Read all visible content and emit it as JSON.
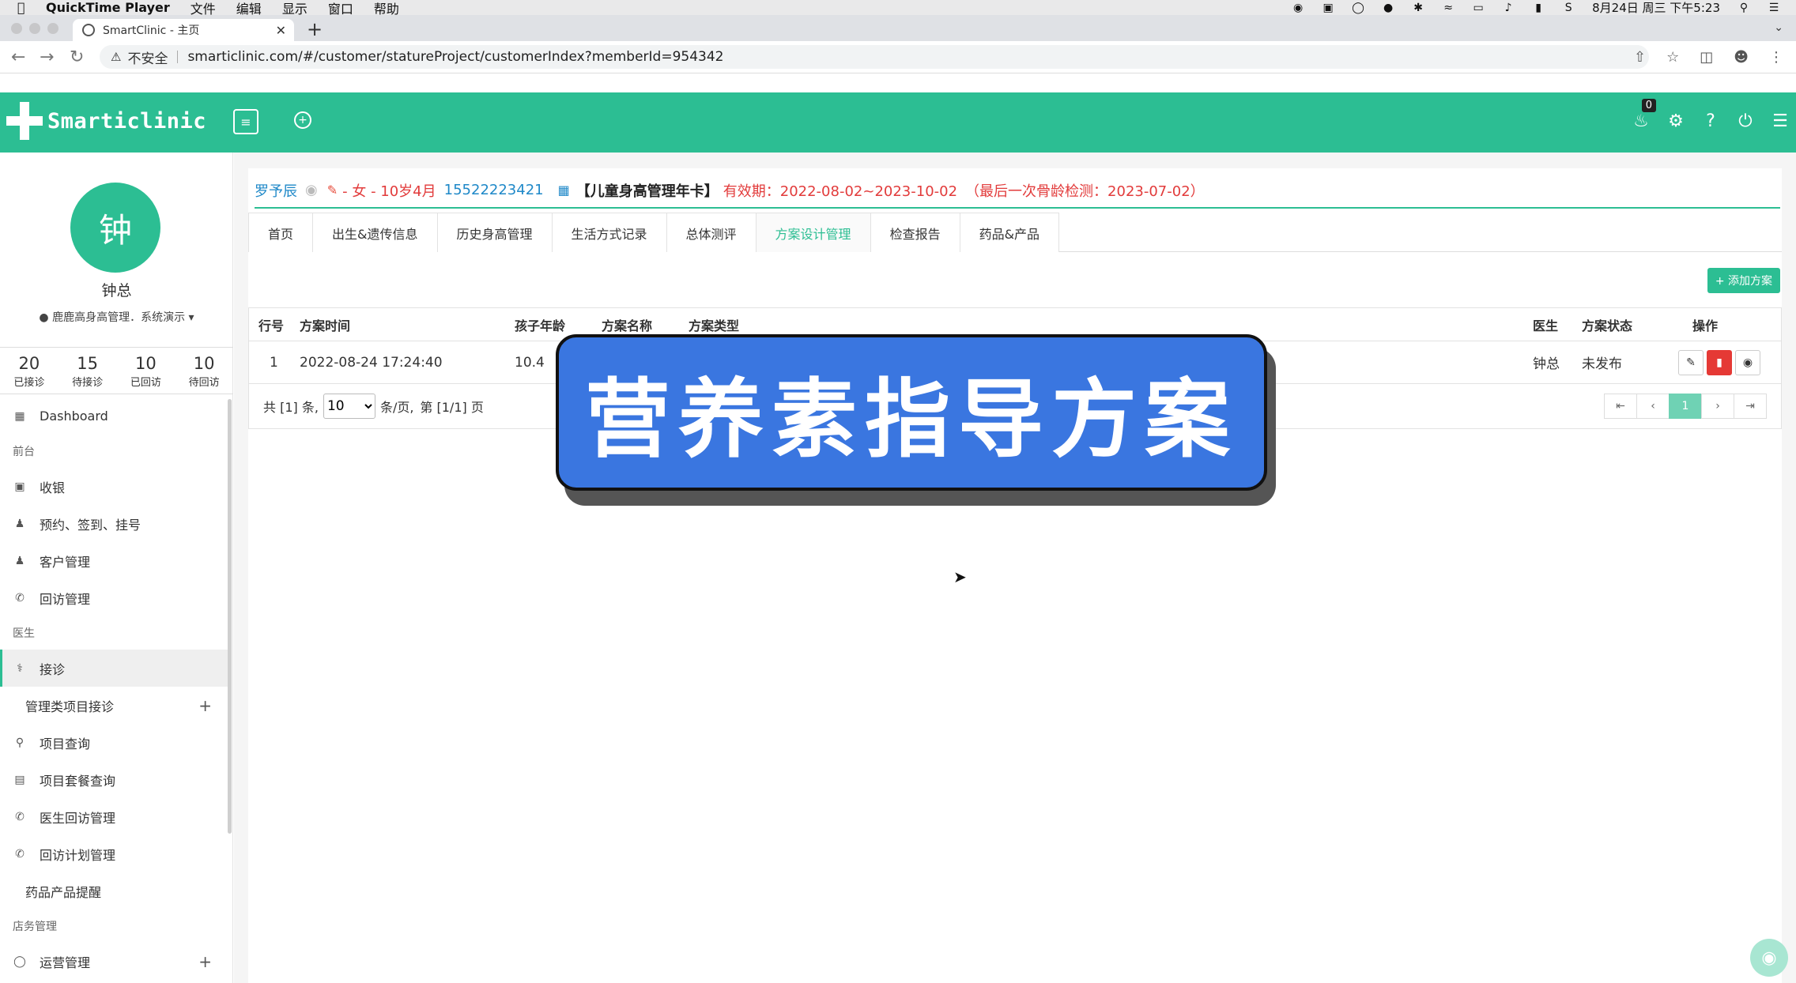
{
  "menubar": {
    "app": "QuickTime Player",
    "items": [
      "文件",
      "编辑",
      "显示",
      "窗口",
      "帮助"
    ],
    "clock": "8月24日 周三 下午5:23"
  },
  "browser": {
    "tab_title": "SmartClinic - 主页",
    "insecure_label": "不安全",
    "url": "smarticlinic.com/#/customer/statureProject/customerIndex?memberId=954342"
  },
  "header": {
    "logo_text": "Smarticlinic",
    "notification_count": "0"
  },
  "user": {
    "avatar_char": "钟",
    "name": "钟总",
    "location": "鹿鹿高身高管理．系统演示"
  },
  "stats": [
    {
      "num": "20",
      "label": "已接诊"
    },
    {
      "num": "15",
      "label": "待接诊"
    },
    {
      "num": "10",
      "label": "已回访"
    },
    {
      "num": "10",
      "label": "待回访"
    }
  ],
  "menu": {
    "dashboard": "Dashboard",
    "sec_front": "前台",
    "cashier": "收银",
    "appointment": "预约、签到、挂号",
    "customer": "客户管理",
    "followup": "回访管理",
    "sec_doctor": "医生",
    "reception": "接诊",
    "mgmt_reception": "管理类项目接诊",
    "project_query": "项目查询",
    "package_query": "项目套餐查询",
    "doctor_followup": "医生回访管理",
    "followup_plan": "回访计划管理",
    "drug_reminder": "药品产品提醒",
    "sec_store": "店务管理",
    "operation": "运营管理"
  },
  "patient": {
    "name": "罗予辰",
    "gender_age": "- 女 - 10岁4月",
    "phone": "15522223421",
    "card": "【儿童身高管理年卡】",
    "validity": "有效期：2022-08-02~2023-10-02",
    "last_check": "（最后一次骨龄检测：2023-07-02）"
  },
  "tabs": [
    "首页",
    "出生&遗传信息",
    "历史身高管理",
    "生活方式记录",
    "总体测评",
    "方案设计管理",
    "检查报告",
    "药品&产品"
  ],
  "add_button": "+ 添加方案",
  "table": {
    "headers": {
      "row_no": "行号",
      "time": "方案时间",
      "age": "孩子年龄",
      "name": "方案名称",
      "type": "方案类型",
      "doctor": "医生",
      "status": "方案状态",
      "ops": "操作"
    },
    "rows": [
      {
        "row_no": "1",
        "time": "2022-08-24 17:24:40",
        "age": "10.4",
        "doctor": "钟总",
        "status": "未发布"
      }
    ]
  },
  "pager": {
    "total": "共 [1] 条,",
    "per_page": "10",
    "per_page_suffix": "条/页,",
    "page_info": "第 [1/1] 页",
    "current": "1"
  },
  "overlay": "营养素指导方案",
  "colors": {
    "brand": "#2cbe93",
    "danger": "#e23b3b",
    "link": "#1e88c8",
    "overlay": "#3a76e0"
  }
}
